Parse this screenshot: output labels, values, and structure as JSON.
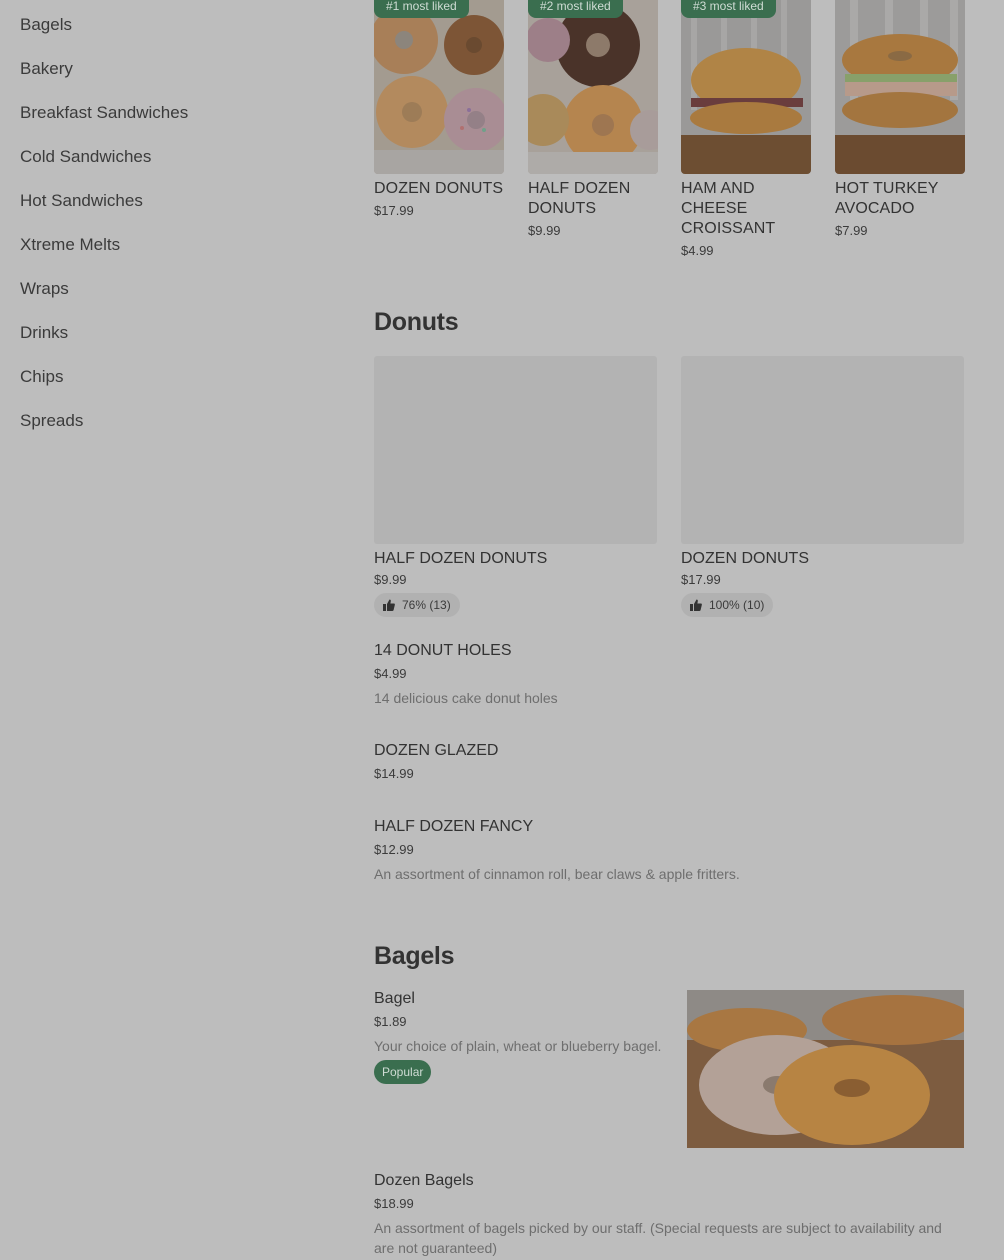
{
  "sidebar": {
    "items": [
      {
        "label": "Bagels"
      },
      {
        "label": "Bakery"
      },
      {
        "label": "Breakfast Sandwiches"
      },
      {
        "label": "Cold Sandwiches"
      },
      {
        "label": "Hot Sandwiches"
      },
      {
        "label": "Xtreme Melts"
      },
      {
        "label": "Wraps"
      },
      {
        "label": "Drinks"
      },
      {
        "label": "Chips"
      },
      {
        "label": "Spreads"
      }
    ]
  },
  "featured": [
    {
      "badge": "#1 most liked",
      "name": "DOZEN DONUTS",
      "price": "$17.99"
    },
    {
      "badge": "#2 most liked",
      "name": "HALF DOZEN DONUTS",
      "price": "$9.99"
    },
    {
      "badge": "#3 most liked",
      "name": "HAM AND CHEESE CROISSANT",
      "price": "$4.99"
    },
    {
      "badge": "",
      "name": "HOT TURKEY AVOCADO",
      "price": "$7.99"
    }
  ],
  "donuts": {
    "title": "Donuts",
    "cards": [
      {
        "name": "HALF DOZEN DONUTS",
        "price": "$9.99",
        "rating": "76% (13)"
      },
      {
        "name": "DOZEN DONUTS",
        "price": "$17.99",
        "rating": "100% (10)"
      }
    ],
    "list": [
      {
        "name": "14 DONUT HOLES",
        "price": "$4.99",
        "desc": "14 delicious cake donut holes"
      },
      {
        "name": "DOZEN GLAZED",
        "price": "$14.99",
        "desc": ""
      },
      {
        "name": "HALF DOZEN FANCY",
        "price": "$12.99",
        "desc": "An assortment of cinnamon roll, bear claws & apple fritters."
      }
    ]
  },
  "bagels": {
    "title": "Bagels",
    "items": [
      {
        "name": "Bagel",
        "price": "$1.89",
        "desc": "Your choice of plain, wheat or blueberry bagel.",
        "tag": "Popular"
      },
      {
        "name": "Dozen Bagels",
        "price": "$18.99",
        "desc": "An assortment of bagels picked by our staff. (Special requests are subject to availability and are not guaranteed)"
      }
    ]
  },
  "colors": {
    "background": "#bdbdbd",
    "accent": "#3a6e4f"
  },
  "icons": [
    "thumbs-up-icon"
  ]
}
